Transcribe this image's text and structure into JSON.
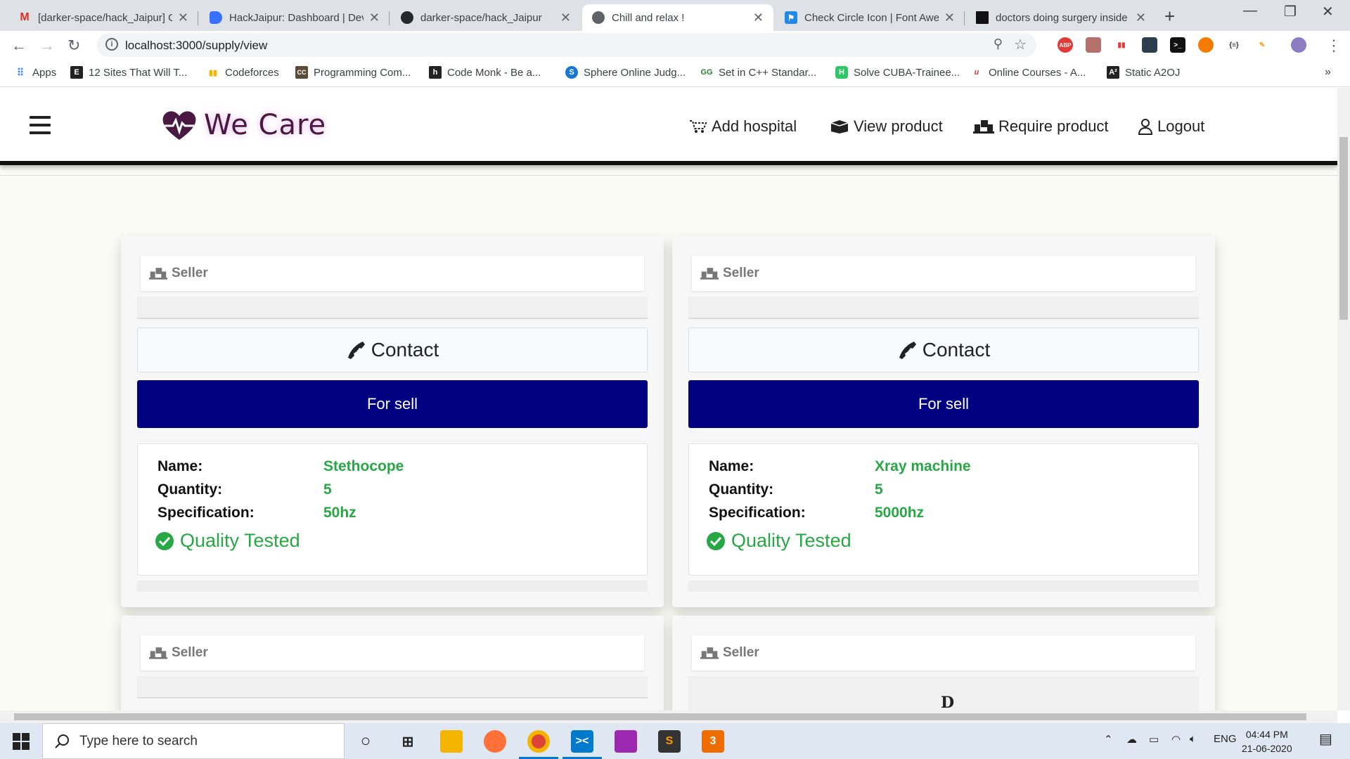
{
  "browser": {
    "tabs": [
      {
        "title": "[darker-space/hack_Jaipur] G",
        "icon": "gmail-icon",
        "color": "#d93025",
        "glyph": "M"
      },
      {
        "title": "HackJaipur: Dashboard | Dev",
        "icon": "devfolio-icon",
        "color": "#3770ff",
        "glyph": ""
      },
      {
        "title": "darker-space/hack_Jaipur",
        "icon": "github-icon",
        "color": "#24292e",
        "glyph": ""
      },
      {
        "title": "Chill and relax !",
        "icon": "globe-icon",
        "color": "#5f6368",
        "glyph": ""
      },
      {
        "title": "Check Circle Icon | Font Awe",
        "icon": "fontawesome-icon",
        "color": "#228ae6",
        "glyph": ""
      },
      {
        "title": "doctors doing surgery inside",
        "icon": "unsplash-icon",
        "color": "#111111",
        "glyph": ""
      }
    ],
    "active_tab_index": 3,
    "url": "localhost:3000/supply/view",
    "bookmarks": [
      {
        "label": "Apps"
      },
      {
        "label": "12 Sites That Will T..."
      },
      {
        "label": "Codeforces"
      },
      {
        "label": "Programming Com..."
      },
      {
        "label": "Code Monk - Be a..."
      },
      {
        "label": "Sphere Online Judg..."
      },
      {
        "label": "Set in C++ Standar..."
      },
      {
        "label": "Solve CUBA-Trainee..."
      },
      {
        "label": "Online Courses - A..."
      },
      {
        "label": "Static A2OJ"
      }
    ],
    "extensions": [
      "ABP"
    ]
  },
  "app": {
    "brand": "We Care",
    "nav": [
      {
        "label": "Add hospital",
        "icon": "cart-icon"
      },
      {
        "label": "View product",
        "icon": "box-open-icon"
      },
      {
        "label": "Require product",
        "icon": "people-carry-icon"
      },
      {
        "label": "Logout",
        "icon": "user-icon"
      }
    ],
    "accent_color": "#000080",
    "success_color": "#28a745"
  },
  "cards": [
    {
      "seller_label": "Seller",
      "contact_label": "Contact",
      "status_label": "For sell",
      "details": [
        {
          "key": "Name:",
          "value": "Stethocope"
        },
        {
          "key": "Quantity:",
          "value": "5"
        },
        {
          "key": "Specification:",
          "value": "50hz"
        }
      ],
      "badge": "Quality Tested"
    },
    {
      "seller_label": "Seller",
      "contact_label": "Contact",
      "status_label": "For sell",
      "details": [
        {
          "key": "Name:",
          "value": "Xray machine"
        },
        {
          "key": "Quantity:",
          "value": "5"
        },
        {
          "key": "Specification:",
          "value": "5000hz"
        }
      ],
      "badge": "Quality Tested"
    },
    {
      "seller_label": "Seller"
    },
    {
      "seller_label": "Seller",
      "partial_text": "D"
    }
  ],
  "taskbar": {
    "search_placeholder": "Type here to search",
    "language": "ENG",
    "time": "04:44 PM",
    "date": "21-06-2020",
    "notification_count": "3"
  }
}
